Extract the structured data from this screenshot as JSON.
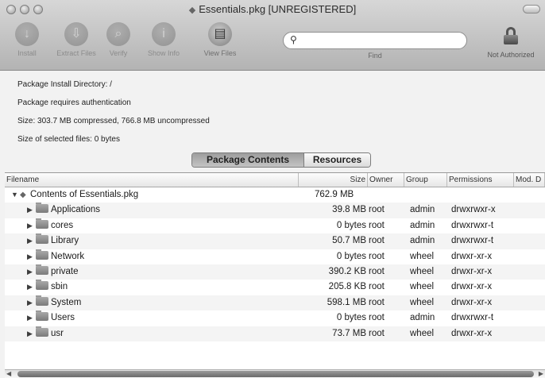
{
  "window": {
    "title": "Essentials.pkg [UNREGISTERED]"
  },
  "toolbar": {
    "items": [
      {
        "label": "Install",
        "icon": "install-icon"
      },
      {
        "label": "Extract Files",
        "icon": "extract-icon"
      },
      {
        "label": "Verify",
        "icon": "verify-icon"
      },
      {
        "label": "Show Info",
        "icon": "info-icon"
      },
      {
        "label": "View Files",
        "icon": "view-files-icon"
      }
    ],
    "search": {
      "value": "",
      "label": "Find"
    },
    "lock_label": "Not Authorized"
  },
  "info": {
    "install_dir": "Package Install Directory: /",
    "auth": "Package requires authentication",
    "size": "Size: 303.7 MB compressed, 766.8 MB uncompressed",
    "selected": "Size of selected files: 0 bytes"
  },
  "tabs": {
    "active": "Package Contents",
    "other": "Resources"
  },
  "table": {
    "columns": [
      "Filename",
      "Size",
      "Owner",
      "Group",
      "Permissions",
      "Mod. D"
    ],
    "root": {
      "name": "Contents of Essentials.pkg",
      "size": "762.9 MB"
    },
    "rows": [
      {
        "name": "Applications",
        "size": "39.8 MB",
        "owner": "root",
        "group": "admin",
        "perm": "drwxrwxr-x"
      },
      {
        "name": "cores",
        "size": "0 bytes",
        "owner": "root",
        "group": "admin",
        "perm": "drwxrwxr-t"
      },
      {
        "name": "Library",
        "size": "50.7 MB",
        "owner": "root",
        "group": "admin",
        "perm": "drwxrwxr-t"
      },
      {
        "name": "Network",
        "size": "0 bytes",
        "owner": "root",
        "group": "wheel",
        "perm": "drwxr-xr-x"
      },
      {
        "name": "private",
        "size": "390.2 KB",
        "owner": "root",
        "group": "wheel",
        "perm": "drwxr-xr-x"
      },
      {
        "name": "sbin",
        "size": "205.8 KB",
        "owner": "root",
        "group": "wheel",
        "perm": "drwxr-xr-x"
      },
      {
        "name": "System",
        "size": "598.1 MB",
        "owner": "root",
        "group": "wheel",
        "perm": "drwxr-xr-x"
      },
      {
        "name": "Users",
        "size": "0 bytes",
        "owner": "root",
        "group": "admin",
        "perm": "drwxrwxr-t"
      },
      {
        "name": "usr",
        "size": "73.7 MB",
        "owner": "root",
        "group": "wheel",
        "perm": "drwxr-xr-x"
      }
    ]
  }
}
